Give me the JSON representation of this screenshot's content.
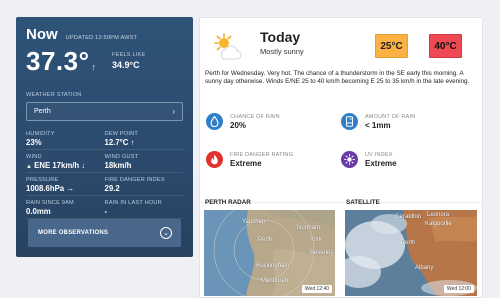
{
  "now": {
    "title": "Now",
    "updated": "UPDATED 12:50PM AWST",
    "temperature": "37.3°",
    "temp_trend_icon": "arrow-up",
    "feels_like_label": "FEELS LIKE",
    "feels_like_value": "34.9°C",
    "weather_station_label": "WEATHER STATION",
    "weather_station_value": "Perth",
    "observations": [
      {
        "label": "HUMIDITY",
        "value": "23%"
      },
      {
        "label": "DEW POINT",
        "value": "12.7°C ↑"
      },
      {
        "label": "WIND",
        "value": "ENE 17km/h ↓"
      },
      {
        "label": "WIND GUST",
        "value": "18km/h"
      },
      {
        "label": "PRESSURE",
        "value": "1008.6hPa →"
      },
      {
        "label": "FIRE DANGER INDEX",
        "value": "29.2"
      },
      {
        "label": "RAIN SINCE 9AM",
        "value": "0.0mm"
      },
      {
        "label": "RAIN IN LAST HOUR",
        "value": "-"
      }
    ],
    "more_button": "MORE OBSERVATIONS"
  },
  "forecast": {
    "title": "Today",
    "summary": "Mostly sunny",
    "min_temp": "25°C",
    "max_temp": "40°C",
    "description": "Perth for Wednesday. Very hot. The chance of a thunderstorm in the SE early this morning. A sunny day otherwise. Winds E/NE 25 to 40 km/h becoming E 25 to 35 km/h in the late evening.",
    "stats": [
      {
        "label": "CHANCE OF RAIN",
        "value": "20%",
        "icon": "raindrop-icon",
        "color": "#2f80c9"
      },
      {
        "label": "AMOUNT OF RAIN",
        "value": "< 1mm",
        "icon": "rain-gauge-icon",
        "color": "#2f80c9"
      },
      {
        "label": "FIRE DANGER RATING",
        "value": "Extreme",
        "icon": "flame-icon",
        "color": "#e0312f"
      },
      {
        "label": "UV INDEX",
        "value": "Extreme",
        "icon": "uv-sun-icon",
        "color": "#6c3aa8"
      }
    ]
  },
  "maps": {
    "radar": {
      "label": "PERTH RADAR",
      "stamp": "Wed 12:40",
      "places": [
        "Yanchep",
        "Perth",
        "Northam",
        "York",
        "Beverley",
        "Rockingham",
        "Mandurah"
      ]
    },
    "satellite": {
      "label": "SATELLITE",
      "stamp": "Wed 12:00",
      "places": [
        "Geraldton",
        "Perth",
        "Albany",
        "Leonora",
        "Kalgoorlie"
      ]
    }
  },
  "colors": {
    "now_panel": "#2f5378",
    "min_badge": "#fcb144",
    "max_badge": "#ef4a53"
  }
}
